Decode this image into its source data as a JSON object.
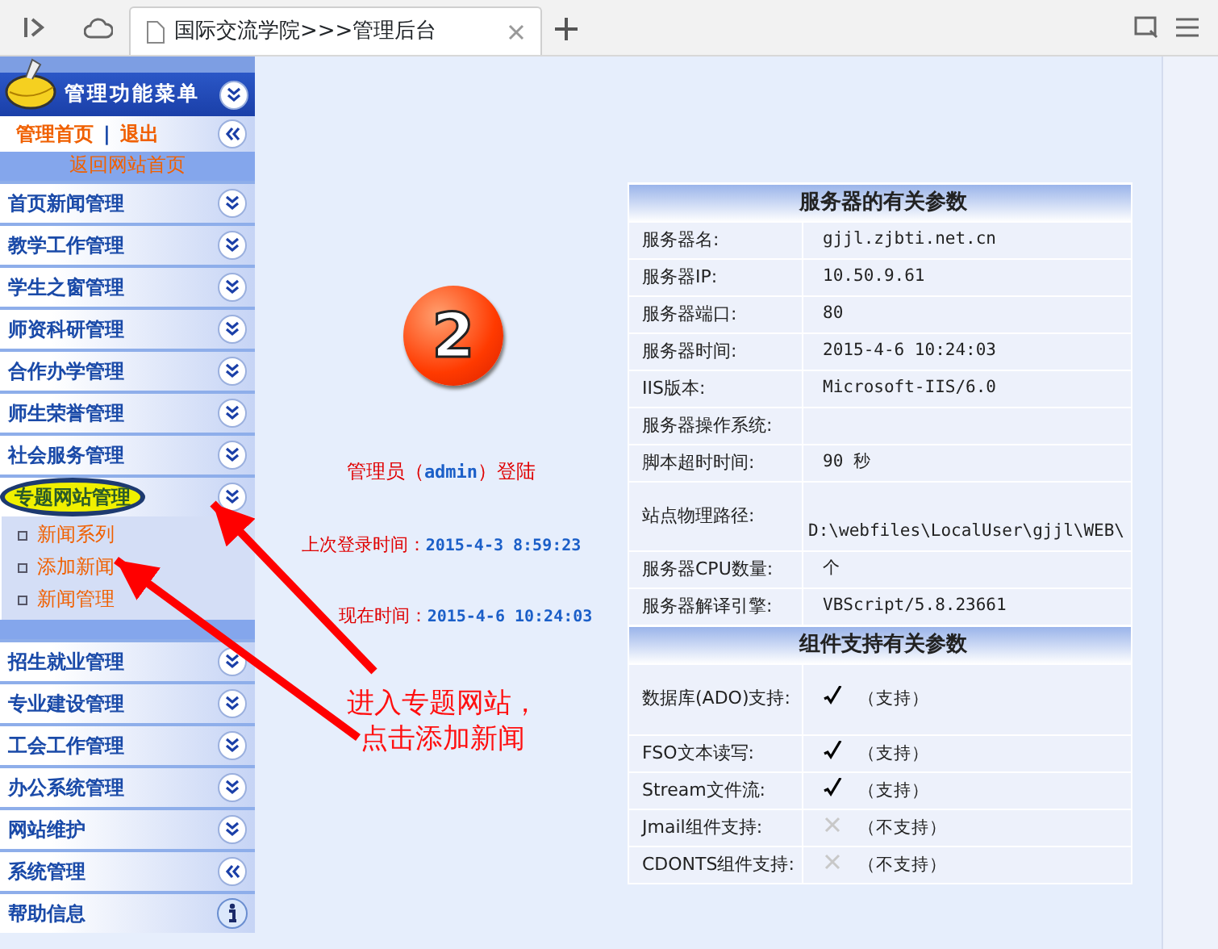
{
  "browser": {
    "tab_title": "国际交流学院>>>管理后台"
  },
  "sidebar": {
    "title": "管理功能菜单",
    "links": [
      "管理首页",
      "退出"
    ],
    "separator": "|",
    "return_link": "返回网站首页",
    "menu": [
      {
        "label": "首页新闻管理",
        "kind": "expand",
        "highlighted": false
      },
      {
        "label": "教学工作管理",
        "kind": "expand",
        "highlighted": false
      },
      {
        "label": "学生之窗管理",
        "kind": "expand",
        "highlighted": false
      },
      {
        "label": "师资科研管理",
        "kind": "expand",
        "highlighted": false
      },
      {
        "label": "合作办学管理",
        "kind": "expand",
        "highlighted": false
      },
      {
        "label": "师生荣誉管理",
        "kind": "expand",
        "highlighted": false
      },
      {
        "label": "社会服务管理",
        "kind": "expand",
        "highlighted": false
      },
      {
        "label": "专题网站管理",
        "kind": "expand",
        "highlighted": true,
        "children": [
          "新闻系列",
          "添加新闻",
          "新闻管理"
        ]
      },
      {
        "label": "招生就业管理",
        "kind": "expand",
        "highlighted": false
      },
      {
        "label": "专业建设管理",
        "kind": "expand",
        "highlighted": false
      },
      {
        "label": "工会工作管理",
        "kind": "expand",
        "highlighted": false
      },
      {
        "label": "办公系统管理",
        "kind": "expand",
        "highlighted": false
      },
      {
        "label": "网站维护",
        "kind": "expand",
        "highlighted": false
      },
      {
        "label": "系统管理",
        "kind": "collapse",
        "highlighted": false
      },
      {
        "label": "帮助信息",
        "kind": "info",
        "highlighted": false
      }
    ]
  },
  "main": {
    "badge": "2",
    "login": "管理员（**admin**）登陆",
    "last_login": {
      "label": "上次登录时间：",
      "value": "2015-4-3 8:59:23"
    },
    "now": {
      "label": "现在时间：",
      "value": "2015-4-6 10:24:03"
    },
    "sections": [
      {
        "title": "服务器的有关参数",
        "rows": [
          {
            "label": "服务器名:",
            "value": "gjjl.zjbti.net.cn"
          },
          {
            "label": "服务器IP:",
            "value": "10.50.9.61"
          },
          {
            "label": "服务器端口:",
            "value": "80"
          },
          {
            "label": "服务器时间:",
            "value": "2015-4-6 10:24:03"
          },
          {
            "label": "IIS版本:",
            "value": "Microsoft-IIS/6.0"
          },
          {
            "label": "服务器操作系统:"
          },
          {
            "label": "脚本超时时间:",
            "value": "90 秒"
          },
          {
            "label": "站点物理路径:",
            "value": "D:\\webfiles\\LocalUser\\gjjl\\WEB\\"
          },
          {
            "label": "服务器CPU数量:",
            "value": "个"
          },
          {
            "label": "服务器解译引擎:",
            "value": "VBScript/5.8.23661"
          }
        ]
      },
      {
        "title": "组件支持有关参数",
        "rows": [
          {
            "label": "数据库(ADO)支持:",
            "supported": true,
            "value": "（支持）"
          },
          {
            "label": "FSO文本读写:",
            "supported": true,
            "value": "（支持）"
          },
          {
            "label": "Stream文件流:",
            "supported": true,
            "value": "（支持）"
          },
          {
            "label": "Jmail组件支持:",
            "supported": false,
            "value": "（不支持）"
          },
          {
            "label": "CDONTS组件支持:",
            "supported": false,
            "value": "（不支持）"
          }
        ]
      }
    ]
  },
  "annotation": {
    "lines": [
      "进入专题网站，",
      "点击添加新闻"
    ]
  }
}
